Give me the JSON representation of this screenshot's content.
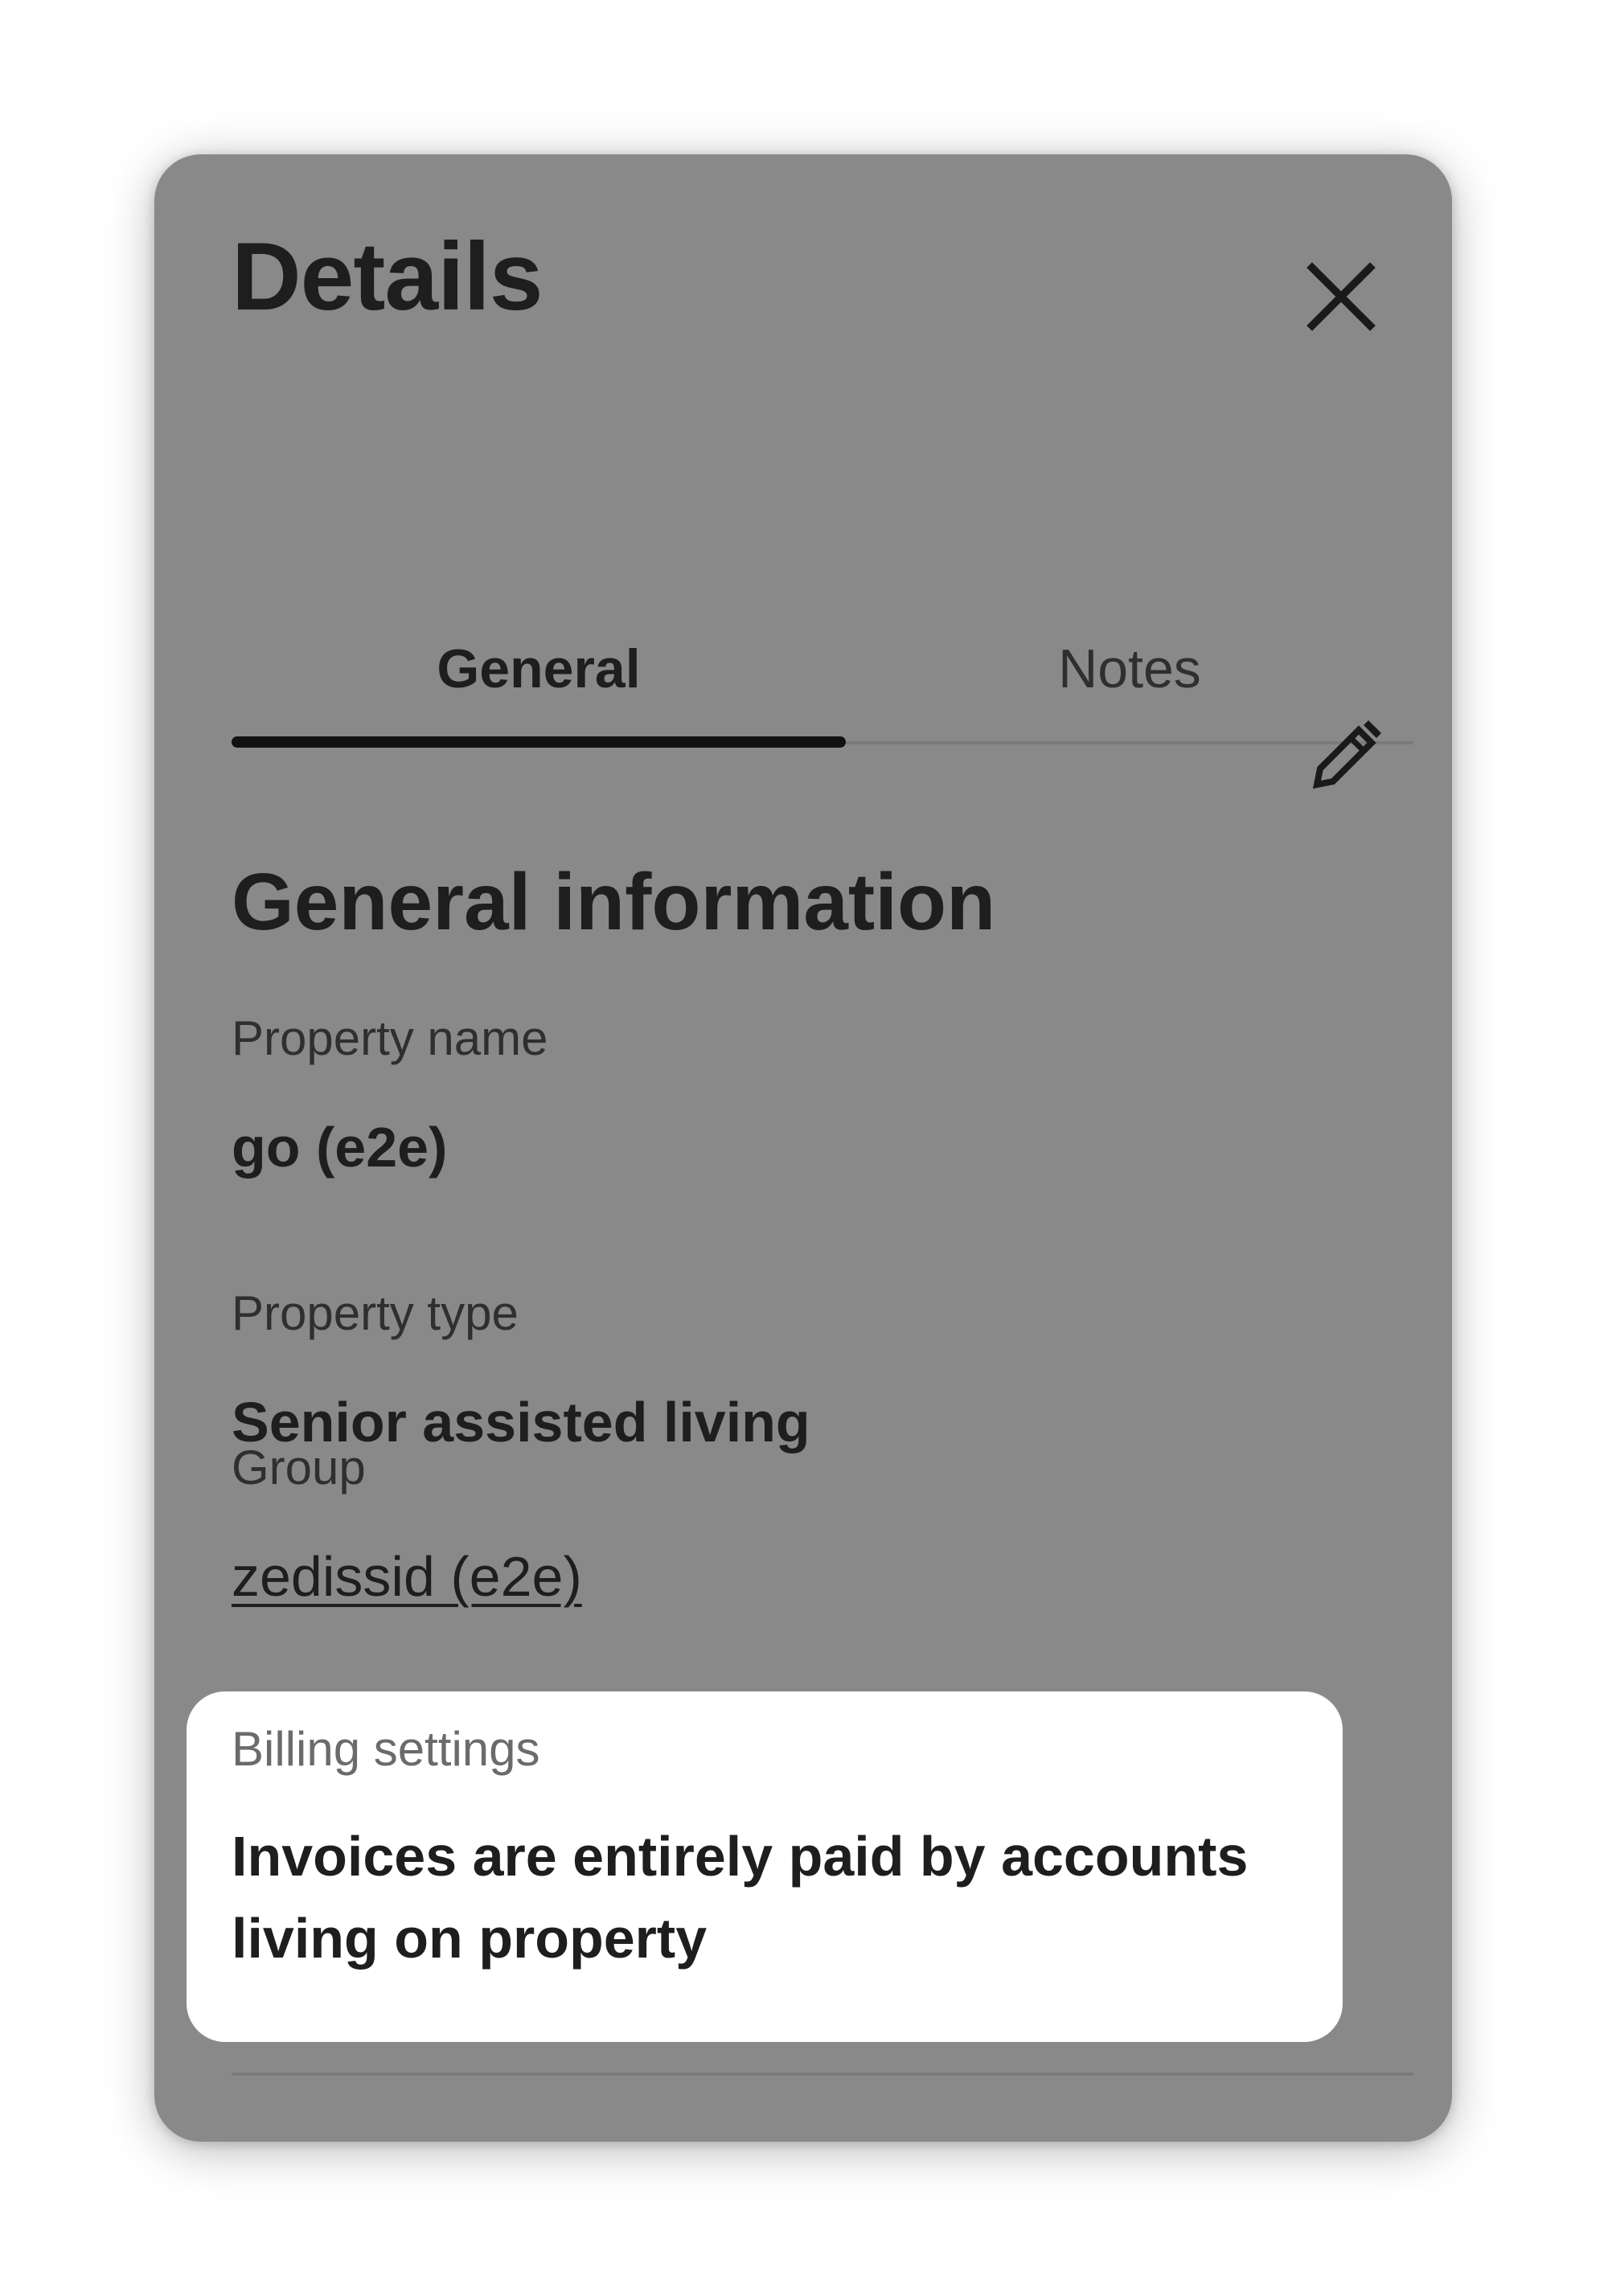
{
  "panel": {
    "title": "Details",
    "close_icon": "close-icon"
  },
  "tabs": [
    {
      "label": "General",
      "active": true
    },
    {
      "label": "Notes",
      "active": false
    }
  ],
  "section": {
    "title": "General information",
    "edit_icon": "pencil-icon"
  },
  "fields": {
    "property_name": {
      "label": "Property name",
      "value": "go (e2e)"
    },
    "property_type": {
      "label": "Property type",
      "value": "Senior assisted living"
    },
    "group": {
      "label": "Group",
      "value": "zedissid (e2e)"
    },
    "billing": {
      "label": "Billing settings",
      "value": "Invoices are entirely paid by accounts living on property"
    }
  },
  "colors": {
    "overlay_panel": "#898989",
    "text_dark": "#1e1e1e",
    "highlight_card": "#ffffff"
  }
}
